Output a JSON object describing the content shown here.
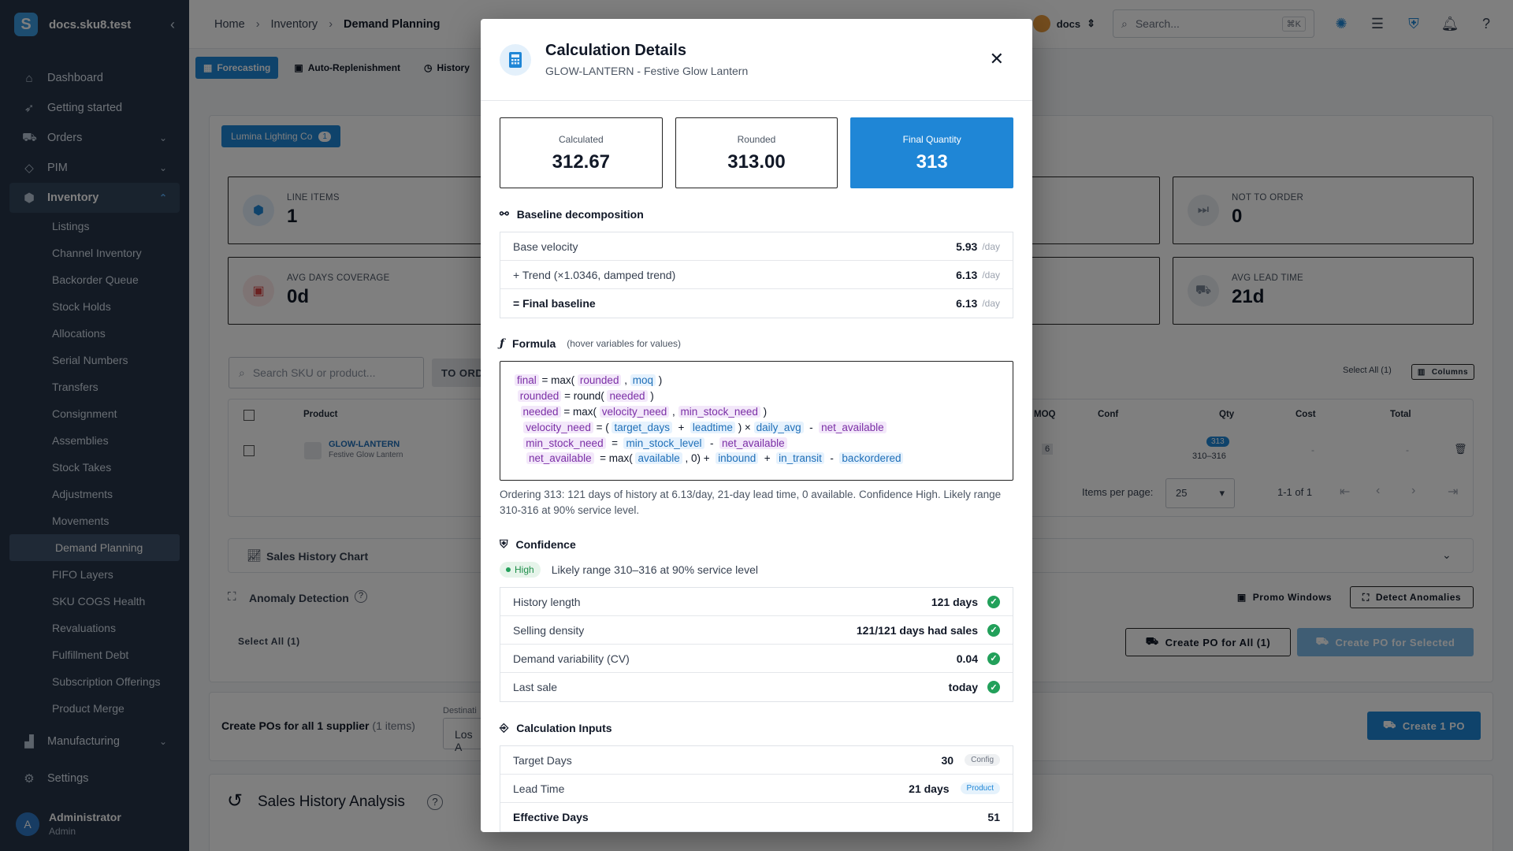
{
  "app": {
    "name": "docs.sku8.test",
    "logo_letter": "S"
  },
  "sidebar": {
    "items": [
      {
        "label": "Dashboard",
        "icon": "home-icon",
        "glyph": "⌂"
      },
      {
        "label": "Getting started",
        "icon": "rocket-icon",
        "glyph": "➶"
      },
      {
        "label": "Orders",
        "icon": "cart-icon",
        "glyph": "⛟",
        "chevron": "⌄"
      },
      {
        "label": "PIM",
        "icon": "tag-icon",
        "glyph": "◇",
        "chevron": "⌄"
      },
      {
        "label": "Inventory",
        "icon": "cube-icon",
        "glyph": "⬢",
        "chevron": "⌃"
      }
    ],
    "inventory_children": [
      "Listings",
      "Channel Inventory",
      "Backorder Queue",
      "Stock Holds",
      "Allocations",
      "Serial Numbers",
      "Transfers",
      "Consignment",
      "Assemblies",
      "Stock Takes",
      "Adjustments",
      "Movements",
      "Demand Planning",
      "FIFO Layers",
      "SKU COGS Health",
      "Revaluations",
      "Fulfillment Debt",
      "Subscription Offerings",
      "Product Merge"
    ],
    "manufacturing": "Manufacturing",
    "settings": "Settings",
    "user": {
      "name": "Administrator",
      "role": "Admin",
      "initial": "A"
    }
  },
  "topbar": {
    "breadcrumbs": [
      "Home",
      "Inventory",
      "Demand Planning"
    ],
    "org": "docs",
    "search_placeholder": "Search...",
    "search_shortcut": "⌘K"
  },
  "tabs": [
    "Forecasting",
    "Auto-Replenishment",
    "History"
  ],
  "background": {
    "supplier_chip": "Lumina Lighting Co",
    "supplier_count": "1",
    "stats": [
      {
        "label": "LINE ITEMS",
        "value": "1"
      },
      {
        "label": "NOT TO ORDER",
        "value": "0"
      },
      {
        "label": "AVG DAYS COVERAGE",
        "value": "0d"
      },
      {
        "label": "AVG LEAD TIME",
        "value": "21d"
      }
    ],
    "search_placeholder": "Search SKU or product...",
    "to_order_btn": "TO ORD",
    "select_all_top": "Select All (1)",
    "columns_btn": "Columns",
    "table_headers": [
      "Product",
      "MOQ",
      "Conf",
      "Qty",
      "Cost",
      "Total"
    ],
    "row": {
      "sku": "GLOW-LANTERN",
      "name": "Festive Glow Lantern",
      "moq": "6",
      "qty_badge": "313",
      "qty_range": "310–316",
      "cost": "-",
      "total": "-"
    },
    "items_per_page_label": "Items per page:",
    "items_per_page": "25",
    "page_range": "1-1 of 1",
    "sales_history_chart": "Sales History Chart",
    "anomaly_detection": "Anomaly Detection",
    "promo_windows": "Promo Windows",
    "detect_anomalies": "Detect Anomalies",
    "select_all_bottom": "Select All (1)",
    "create_po_all": "Create PO for All (1)",
    "create_po_selected": "Create PO for Selected",
    "create_pos_text": "Create POs for all 1 supplier",
    "create_pos_items": "(1 items)",
    "destination_label": "Destinati",
    "destination_value": "Los A",
    "create_1_po": "Create 1 PO",
    "sales_history_analysis": "Sales History Analysis"
  },
  "modal": {
    "title": "Calculation Details",
    "subtitle": "GLOW-LANTERN - Festive Glow Lantern",
    "quantities": [
      {
        "label": "Calculated",
        "value": "312.67"
      },
      {
        "label": "Rounded",
        "value": "313.00"
      },
      {
        "label": "Final Quantity",
        "value": "313"
      }
    ],
    "baseline_title": "Baseline decomposition",
    "baseline_rows": [
      {
        "label": "Base velocity",
        "value": "5.93",
        "unit": "/day"
      },
      {
        "label": "+ Trend (×1.0346, damped trend)",
        "value": "6.13",
        "unit": "/day"
      },
      {
        "label": "= Final baseline",
        "value": "6.13",
        "unit": "/day"
      }
    ],
    "formula_title": "Formula",
    "formula_hint": "(hover variables for values)",
    "formula_lines": [
      [
        [
          "final",
          "p"
        ],
        [
          " = max( ",
          ""
        ],
        [
          "rounded",
          "p"
        ],
        [
          " , ",
          ""
        ],
        [
          "moq",
          "b"
        ],
        [
          " )",
          ""
        ]
      ],
      [
        [
          " ",
          ""
        ],
        [
          "rounded",
          "p"
        ],
        [
          " = round( ",
          ""
        ],
        [
          "needed",
          "p"
        ],
        [
          " )",
          ""
        ]
      ],
      [
        [
          "  ",
          ""
        ],
        [
          "needed",
          "p"
        ],
        [
          " = max( ",
          ""
        ],
        [
          "velocity_need",
          "p"
        ],
        [
          " , ",
          ""
        ],
        [
          "min_stock_need",
          "p"
        ],
        [
          " )",
          ""
        ]
      ],
      [
        [
          "   ",
          ""
        ],
        [
          "velocity_need",
          "p"
        ],
        [
          " = ( ",
          ""
        ],
        [
          "target_days",
          "b"
        ],
        [
          "  +  ",
          ""
        ],
        [
          "leadtime",
          "b"
        ],
        [
          " ) × ",
          ""
        ],
        [
          "daily_avg",
          "b"
        ],
        [
          "  -  ",
          ""
        ],
        [
          "net_available",
          "p"
        ]
      ],
      [
        [
          "   ",
          ""
        ],
        [
          "min_stock_need",
          "p"
        ],
        [
          "  =  ",
          ""
        ],
        [
          "min_stock_level",
          "b"
        ],
        [
          "  -  ",
          ""
        ],
        [
          "net_available",
          "p"
        ]
      ],
      [
        [
          "    ",
          ""
        ],
        [
          "net_available",
          "p"
        ],
        [
          "  = max( ",
          ""
        ],
        [
          "available",
          "b"
        ],
        [
          " , 0) +  ",
          ""
        ],
        [
          "inbound",
          "b"
        ],
        [
          "  +  ",
          ""
        ],
        [
          "in_transit",
          "b"
        ],
        [
          "  -  ",
          ""
        ],
        [
          "backordered",
          "b"
        ]
      ]
    ],
    "explanation": "Ordering 313: 121 days of history at 6.13/day, 21-day lead time, 0 available. Confidence High. Likely range 310-316 at 90% service level.",
    "confidence_title": "Confidence",
    "confidence_badge": "High",
    "confidence_text": "Likely range 310–316 at 90% service level",
    "confidence_rows": [
      {
        "label": "History length",
        "value": "121 days"
      },
      {
        "label": "Selling density",
        "value": "121/121 days had sales"
      },
      {
        "label": "Demand variability (CV)",
        "value": "0.04"
      },
      {
        "label": "Last sale",
        "value": "today"
      }
    ],
    "inputs_title": "Calculation Inputs",
    "inputs_rows": [
      {
        "label": "Target Days",
        "value": "30",
        "tag": "Config"
      },
      {
        "label": "Lead Time",
        "value": "21 days",
        "tag": "Product"
      },
      {
        "label": "Effective Days",
        "value": "51",
        "tag": ""
      }
    ]
  },
  "colors": {
    "accent": "#1f86d6",
    "sidebar": "#263548",
    "success": "#22a05a"
  }
}
